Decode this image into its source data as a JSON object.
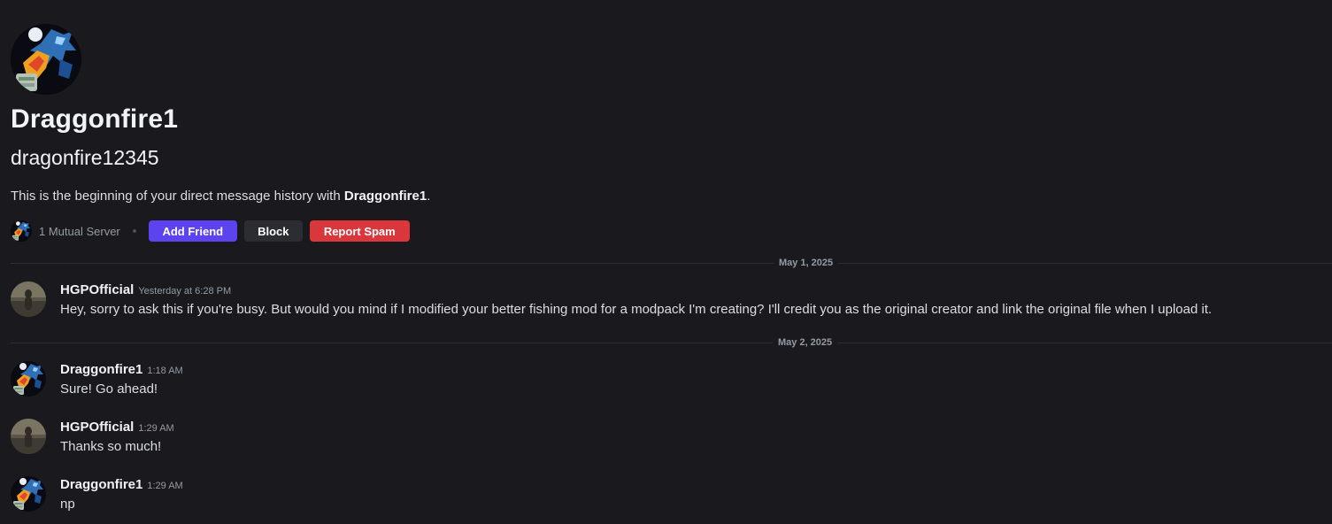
{
  "profile": {
    "display_name": "Draggonfire1",
    "username": "dragonfire12345",
    "intro_prefix": "This is the beginning of your direct message history with ",
    "intro_name": "Draggonfire1",
    "intro_suffix": "."
  },
  "actions": {
    "mutual_servers": "1 Mutual Server",
    "add_friend": "Add Friend",
    "block": "Block",
    "report_spam": "Report Spam"
  },
  "dividers": [
    {
      "label": "May 1, 2025"
    },
    {
      "label": "May 2, 2025"
    }
  ],
  "messages": [
    {
      "author": "HGPOfficial",
      "time": "Yesterday at 6:28 PM",
      "text": "Hey, sorry to ask this if you're busy. But would you mind if I modified your better fishing mod for a modpack I'm creating? I'll credit you as the original creator and link the original file when I upload it.",
      "avatar": "hgp-avatar"
    },
    {
      "author": "Draggonfire1",
      "time": "1:18 AM",
      "text": "Sure! Go ahead!",
      "avatar": "dragon-avatar"
    },
    {
      "author": "HGPOfficial",
      "time": "1:29 AM",
      "text": "Thanks so much!",
      "avatar": "hgp-avatar"
    },
    {
      "author": "Draggonfire1",
      "time": "1:29 AM",
      "text": "np",
      "avatar": "dragon-avatar"
    }
  ],
  "colors": {
    "background": "#1a1a1e",
    "add_friend": "#5b44f0",
    "block": "#2b2d31",
    "report_spam": "#da373c",
    "muted_text": "#949ba4"
  }
}
